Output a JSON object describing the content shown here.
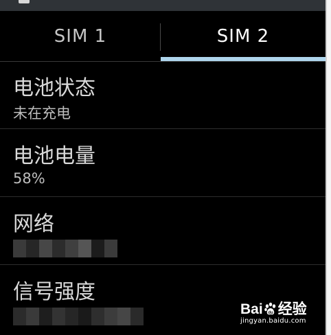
{
  "tabs": [
    {
      "label": "SIM 1",
      "selected": false
    },
    {
      "label": "SIM 2",
      "selected": true
    }
  ],
  "list": [
    {
      "title": "电池状态",
      "value": "未在充电"
    },
    {
      "title": "电池电量",
      "value": "58%"
    },
    {
      "title": "网络",
      "value": ""
    },
    {
      "title": "信号强度",
      "value": ""
    }
  ],
  "watermark": {
    "logo_left": "Bai",
    "logo_right": "经验",
    "url": "jingyan.baidu.com"
  },
  "colors": {
    "background": "#000000",
    "tab_indicator": "#aed5ec",
    "title_text": "#d9d9d9",
    "value_text": "#bdbdbd",
    "topbar": "#2f3337"
  },
  "icons": [
    "status-bar-icon",
    "baidu-paw-icon"
  ]
}
